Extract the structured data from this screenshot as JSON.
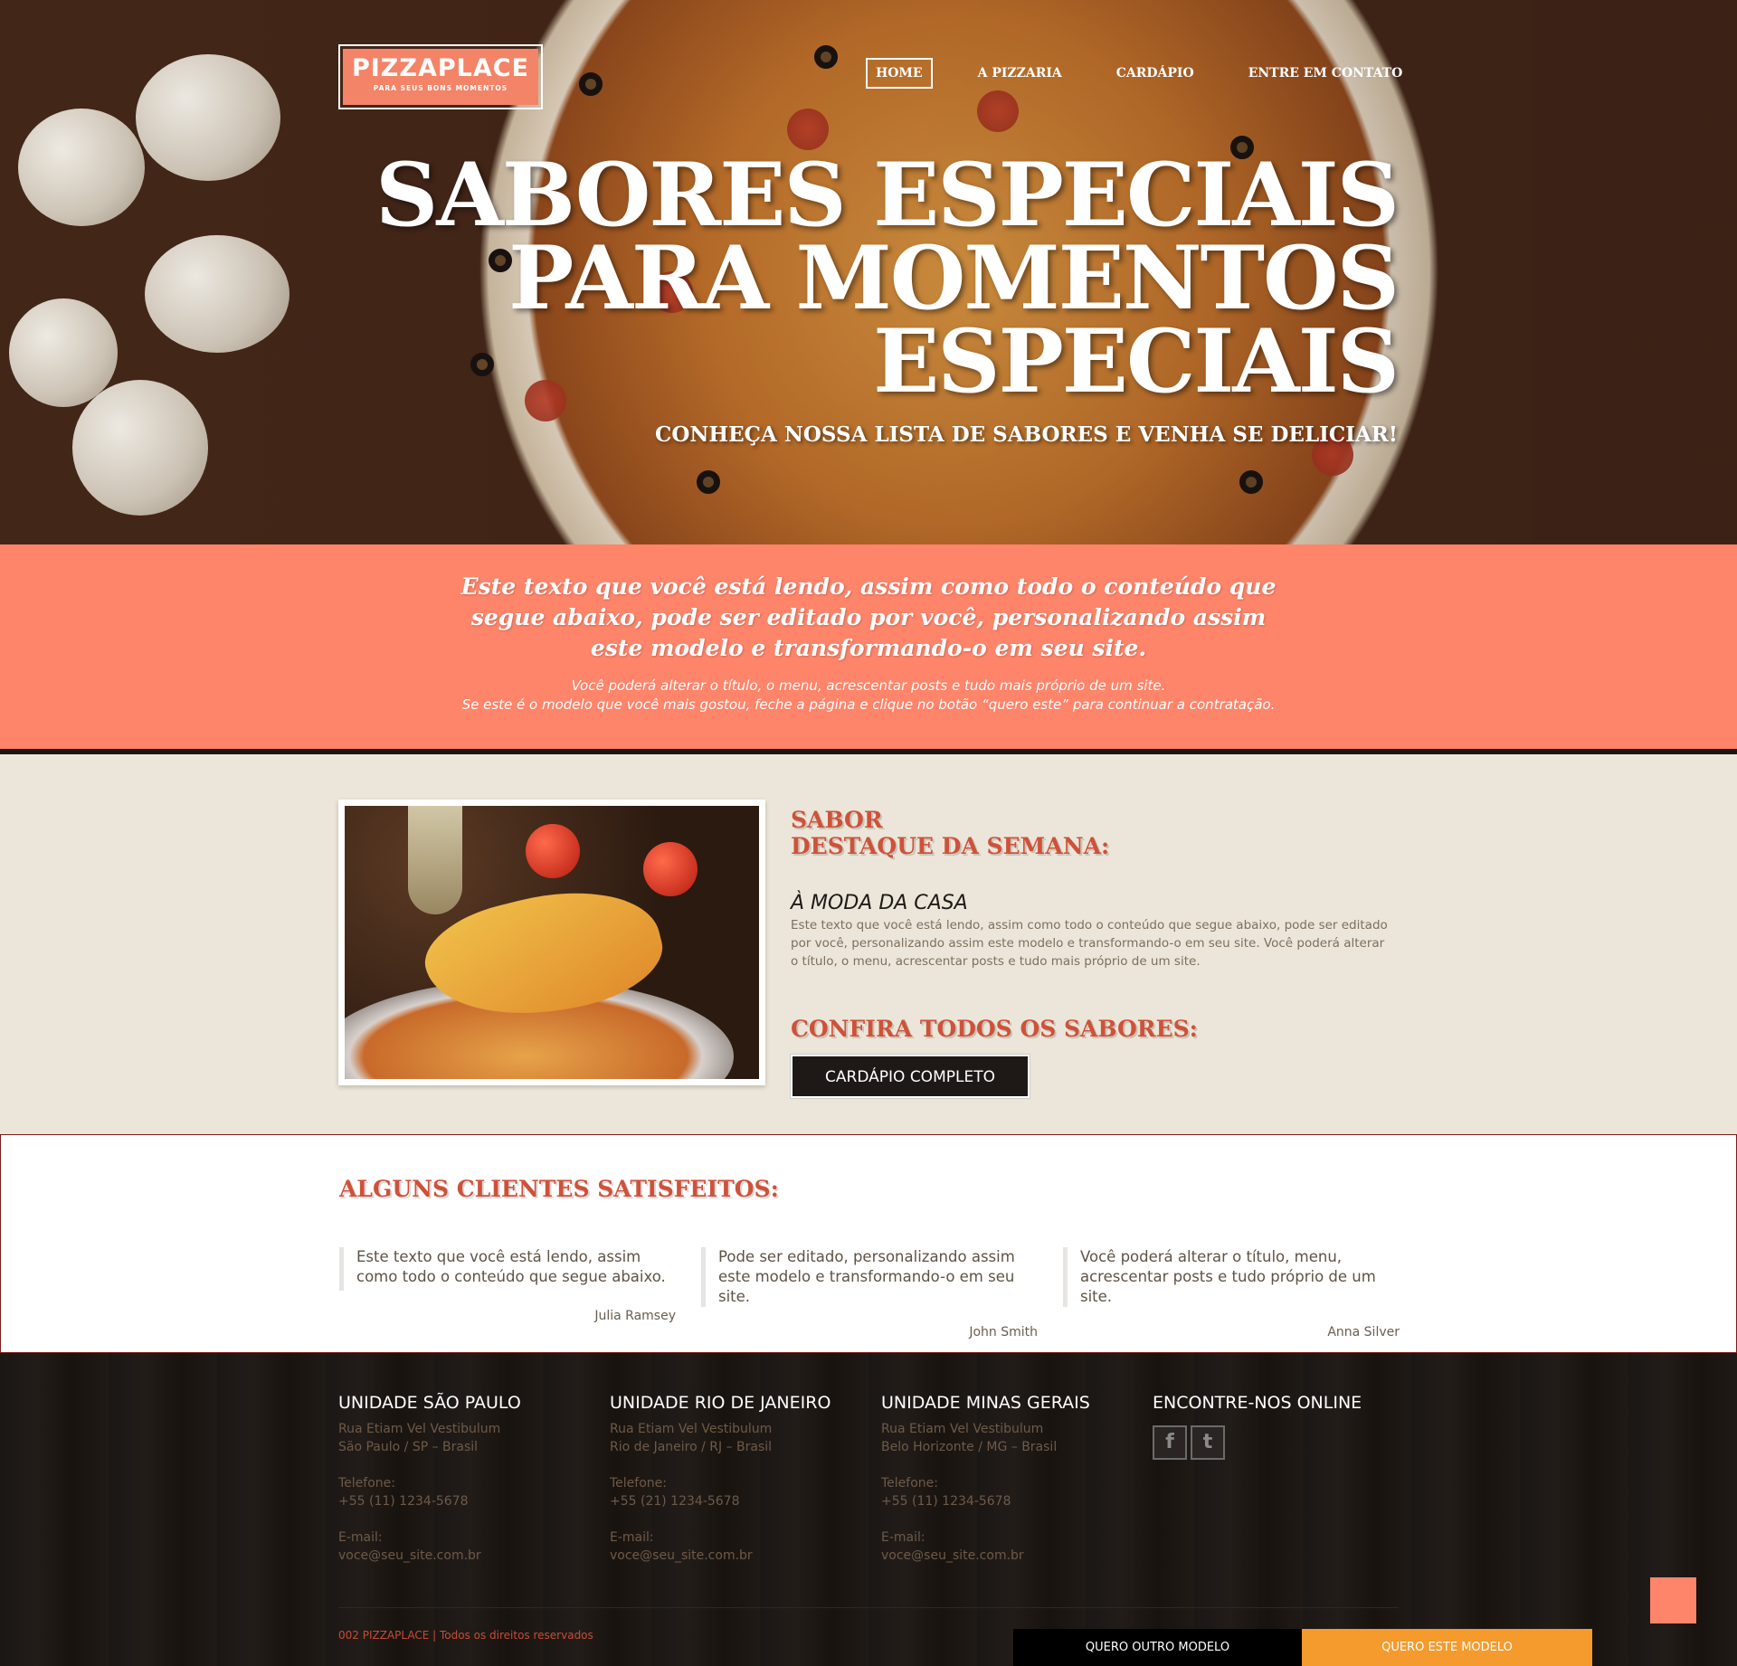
{
  "logo": {
    "title": "PIZZAPLACE",
    "subtitle": "PARA SEUS BONS MOMENTOS"
  },
  "nav": {
    "home": "HOME",
    "items": [
      "A PIZZARIA",
      "CARDÁPIO",
      "ENTRE EM CONTATO"
    ]
  },
  "hero": {
    "title_lines": [
      "SABORES ESPECIAIS",
      "PARA MOMENTOS",
      "ESPECIAIS"
    ],
    "subtitle": "CONHEÇA NOSSA LISTA DE SABORES E VENHA SE DELICIAR!"
  },
  "intro": {
    "lead": "Este texto que você está lendo, assim como todo o conteúdo que segue abaixo, pode ser editado por você, personalizando assim este modelo e transformando-o em seu site.",
    "line1": "Você poderá alterar o título, o menu, acrescentar posts e tudo mais próprio de um site.",
    "line2": "Se este é o modelo que você mais gostou, feche a página e clique no botão “quero este” para continuar a contratação."
  },
  "featured": {
    "heading_line1": "SABOR",
    "heading_line2": "DESTAQUE DA SEMANA:",
    "name": "À MODA DA CASA",
    "description": "Este texto que você está lendo, assim como todo o conteúdo que segue abaixo, pode ser editado por você, personalizando assim este modelo e transformando-o em seu site. Você poderá alterar o título, o menu, acrescentar posts e tudo mais próprio de um site.",
    "heading2": "CONFIRA TODOS OS SABORES:",
    "button": "CARDÁPIO COMPLETO"
  },
  "testimonials": {
    "heading": "ALGUNS CLIENTES SATISFEITOS:",
    "items": [
      {
        "quote": "Este texto que você está lendo, assim como todo o conteúdo que segue abaixo.",
        "author": "Julia Ramsey"
      },
      {
        "quote": "Pode ser editado, personalizando assim este modelo e transformando-o em seu site.",
        "author": "John Smith"
      },
      {
        "quote": "Você poderá alterar o título, menu, acrescentar posts e tudo próprio de um site.",
        "author": "Anna Silver"
      }
    ]
  },
  "footer": {
    "units": [
      {
        "title": "UNIDADE SÃO PAULO",
        "street": "Rua Etiam Vel Vestibulum",
        "city": "São Paulo / SP – Brasil",
        "phone_label": "Telefone:",
        "phone": "+55 (11) 1234-5678",
        "email_label": "E-mail:",
        "email": "voce@seu_site.com.br"
      },
      {
        "title": "UNIDADE RIO DE JANEIRO",
        "street": "Rua Etiam Vel Vestibulum",
        "city": "Rio de Janeiro / RJ – Brasil",
        "phone_label": "Telefone:",
        "phone": "+55 (21) 1234-5678",
        "email_label": "E-mail:",
        "email": "voce@seu_site.com.br"
      },
      {
        "title": "UNIDADE MINAS GERAIS",
        "street": "Rua Etiam Vel Vestibulum",
        "city": "Belo Horizonte / MG – Brasil",
        "phone_label": "Telefone:",
        "phone": "+55 (11) 1234-5678",
        "email_label": "E-mail:",
        "email": "voce@seu_site.com.br"
      }
    ],
    "online_title": "ENCONTRE-NOS ONLINE",
    "social": [
      {
        "icon": "facebook-icon",
        "glyph": "f"
      },
      {
        "icon": "twitter-icon",
        "glyph": "t"
      }
    ],
    "copyright": "002 PIZZAPLACE | Todos os direitos reservados",
    "btn_other": "QUERO OUTRO MODELO",
    "btn_this": "QUERO ESTE MODELO"
  },
  "colors": {
    "accent": "#fe846a",
    "heading_red": "#ce523a",
    "cta_orange": "#f59a2c"
  }
}
